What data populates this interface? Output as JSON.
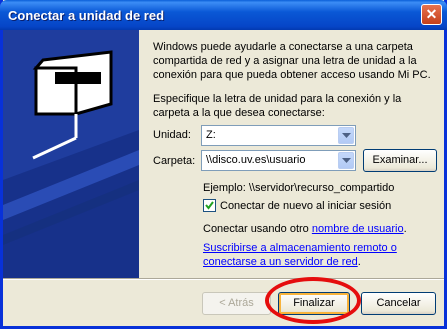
{
  "window": {
    "title": "Conectar a unidad de red",
    "close_label": "✕"
  },
  "intro_text": [
    "Windows puede ayudarle a conectarse a una carpeta",
    "compartida de red y a asignar una letra de unidad a la",
    "conexión para que pueda obtener acceso usando Mi PC."
  ],
  "specify_text": [
    "Especifique la letra de unidad para la conexión y la",
    "carpeta a la que desea conectarse:"
  ],
  "drive": {
    "label": "Unidad:",
    "value": "Z:"
  },
  "folder": {
    "label": "Carpeta:",
    "value": "\\\\disco.uv.es\\usuario"
  },
  "browse_button": "Examinar...",
  "example": "Ejemplo: \\\\servidor\\recurso_compartido",
  "reconnect": {
    "label": "Conectar de nuevo al iniciar sesión",
    "checked": true
  },
  "other_user": {
    "prefix": "Conectar usando otro ",
    "link": "nombre de usuario",
    "suffix": "."
  },
  "storage_link": [
    "Suscribirse a almacenamiento remoto o",
    "conectarse a un servidor de red"
  ],
  "storage_suffix": ".",
  "buttons": {
    "back": "< Atrás",
    "finish": "Finalizar",
    "cancel": "Cancelar"
  },
  "colors": {
    "title_bar": "#0a58d6",
    "side_panel": "#1f3d9e",
    "highlight_circle": "#e50d0d"
  }
}
